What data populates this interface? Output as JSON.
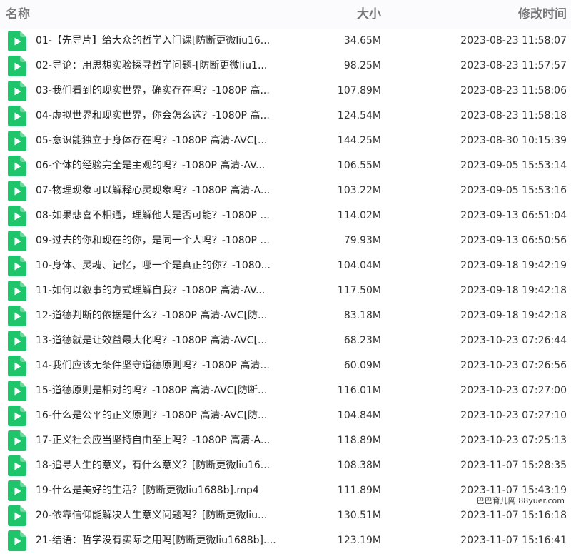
{
  "header": {
    "name_label": "名称",
    "size_label": "大小",
    "date_label": "修改时间"
  },
  "colors": {
    "icon_green": "#1fc56b",
    "header_text": "#777777",
    "header_bg": "#fbfbfd"
  },
  "icon": "video-file-play-icon",
  "files": [
    {
      "name": "01-【先导片】给大众的哲学入门课[防断更微liu16...",
      "size": "34.65M",
      "date": "2023-08-23 11:58:07"
    },
    {
      "name": "02-导论：用思想实验探寻哲学问题-[防断更微liu1...",
      "size": "98.25M",
      "date": "2023-08-23 11:57:57"
    },
    {
      "name": "03-我们看到的现实世界，确实存在吗？-1080P 高...",
      "size": "107.89M",
      "date": "2023-08-23 11:58:06"
    },
    {
      "name": "04-虚拟世界和现实世界，你会怎么选？-1080P 高...",
      "size": "124.54M",
      "date": "2023-08-23 11:58:18"
    },
    {
      "name": "05-意识能独立于身体存在吗？-1080P 高清-AVC[...",
      "size": "144.25M",
      "date": "2023-08-30 10:15:39"
    },
    {
      "name": "06-个体的经验完全是主观的吗？-1080P 高清-AV...",
      "size": "106.55M",
      "date": "2023-09-05 15:53:14"
    },
    {
      "name": "07-物理现象可以解释心灵现象吗？-1080P 高清-A...",
      "size": "103.22M",
      "date": "2023-09-05 15:53:16"
    },
    {
      "name": "08-如果悲喜不相通，理解他人是否可能？-1080P ...",
      "size": "114.02M",
      "date": "2023-09-13 06:51:04"
    },
    {
      "name": "09-过去的你和现在的你，是同一个人吗？-1080P ...",
      "size": "79.93M",
      "date": "2023-09-13 06:50:56"
    },
    {
      "name": "10-身体、灵魂、记忆，哪一个是真正的你？-1080...",
      "size": "104.04M",
      "date": "2023-09-18 19:42:19"
    },
    {
      "name": "11-如何以叙事的方式理解自我？-1080P 高清-AV...",
      "size": "117.50M",
      "date": "2023-09-18 19:42:18"
    },
    {
      "name": "12-道德判断的依据是什么？-1080P 高清-AVC[防...",
      "size": "83.18M",
      "date": "2023-09-18 19:42:18"
    },
    {
      "name": "13-道德就是让效益最大化吗？-1080P 高清-AVC[...",
      "size": "68.23M",
      "date": "2023-10-23 07:26:44"
    },
    {
      "name": "14-我们应该无条件坚守道德原则吗？-1080P 高清...",
      "size": "60.09M",
      "date": "2023-10-23 07:26:56"
    },
    {
      "name": "15-道德原则是相对的吗？-1080P 高清-AVC[防断...",
      "size": "116.01M",
      "date": "2023-10-23 07:27:00"
    },
    {
      "name": "16-什么是公平的正义原则？-1080P 高清-AVC[防...",
      "size": "104.84M",
      "date": "2023-10-23 07:27:10"
    },
    {
      "name": "17-正义社会应当坚持自由至上吗？-1080P 高清-A...",
      "size": "118.89M",
      "date": "2023-10-23 07:25:13"
    },
    {
      "name": "18-追寻人生的意义，有什么意义？[防断更微liu16...",
      "size": "108.38M",
      "date": "2023-11-07 15:28:35"
    },
    {
      "name": "19-什么是美好的生活？[防断更微liu1688b].mp4",
      "size": "111.89M",
      "date": "2023-11-07 15:43:19"
    },
    {
      "name": "20-依靠信仰能解决人生意义问题吗？[防断更微liu...",
      "size": "130.51M",
      "date": "2023-11-07 15:16:18"
    },
    {
      "name": "21-结语：哲学没有实际之用吗[防断更微liu1688b]....",
      "size": "123.19M",
      "date": "2023-11-07 15:16:41"
    }
  ],
  "watermark": "巴巴育儿网 88yuer.com"
}
